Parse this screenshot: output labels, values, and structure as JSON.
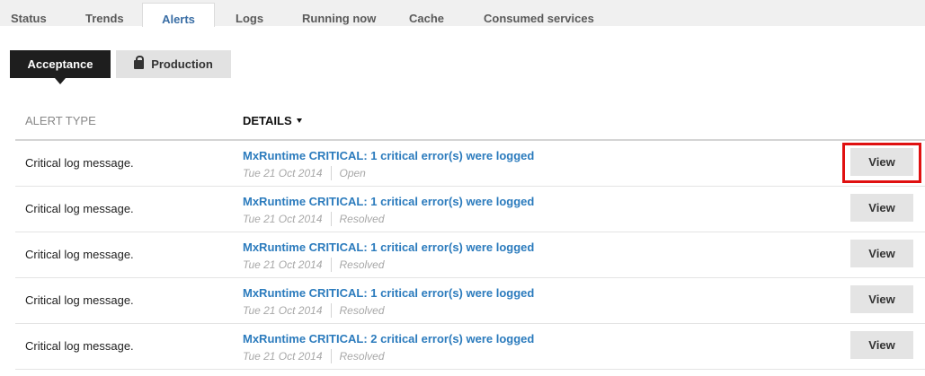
{
  "tabs": [
    "Status",
    "Trends",
    "Alerts",
    "Logs",
    "Running now",
    "Cache",
    "Consumed services"
  ],
  "environment": {
    "selected": "Acceptance",
    "other": "Production"
  },
  "table": {
    "headers": {
      "type": "ALERT TYPE",
      "details": "DETAILS"
    },
    "rows": [
      {
        "type": "Critical log message.",
        "message": "MxRuntime CRITICAL: 1 critical error(s) were logged",
        "date": "Tue 21 Oct 2014",
        "status": "Open",
        "action": "View"
      },
      {
        "type": "Critical log message.",
        "message": "MxRuntime CRITICAL: 1 critical error(s) were logged",
        "date": "Tue 21 Oct 2014",
        "status": "Resolved",
        "action": "View"
      },
      {
        "type": "Critical log message.",
        "message": "MxRuntime CRITICAL: 1 critical error(s) were logged",
        "date": "Tue 21 Oct 2014",
        "status": "Resolved",
        "action": "View"
      },
      {
        "type": "Critical log message.",
        "message": "MxRuntime CRITICAL: 1 critical error(s) were logged",
        "date": "Tue 21 Oct 2014",
        "status": "Resolved",
        "action": "View"
      },
      {
        "type": "Critical log message.",
        "message": "MxRuntime CRITICAL: 2 critical error(s) were logged",
        "date": "Tue 21 Oct 2014",
        "status": "Resolved",
        "action": "View"
      }
    ]
  },
  "colors": {
    "link": "#2b7bbd",
    "active_tab": "#3a6ea5",
    "highlight": "#e01010",
    "selected_env": "#1e1e1e"
  },
  "icons": {
    "production_lock": "lock-icon",
    "sort": "sort-desc-icon"
  }
}
